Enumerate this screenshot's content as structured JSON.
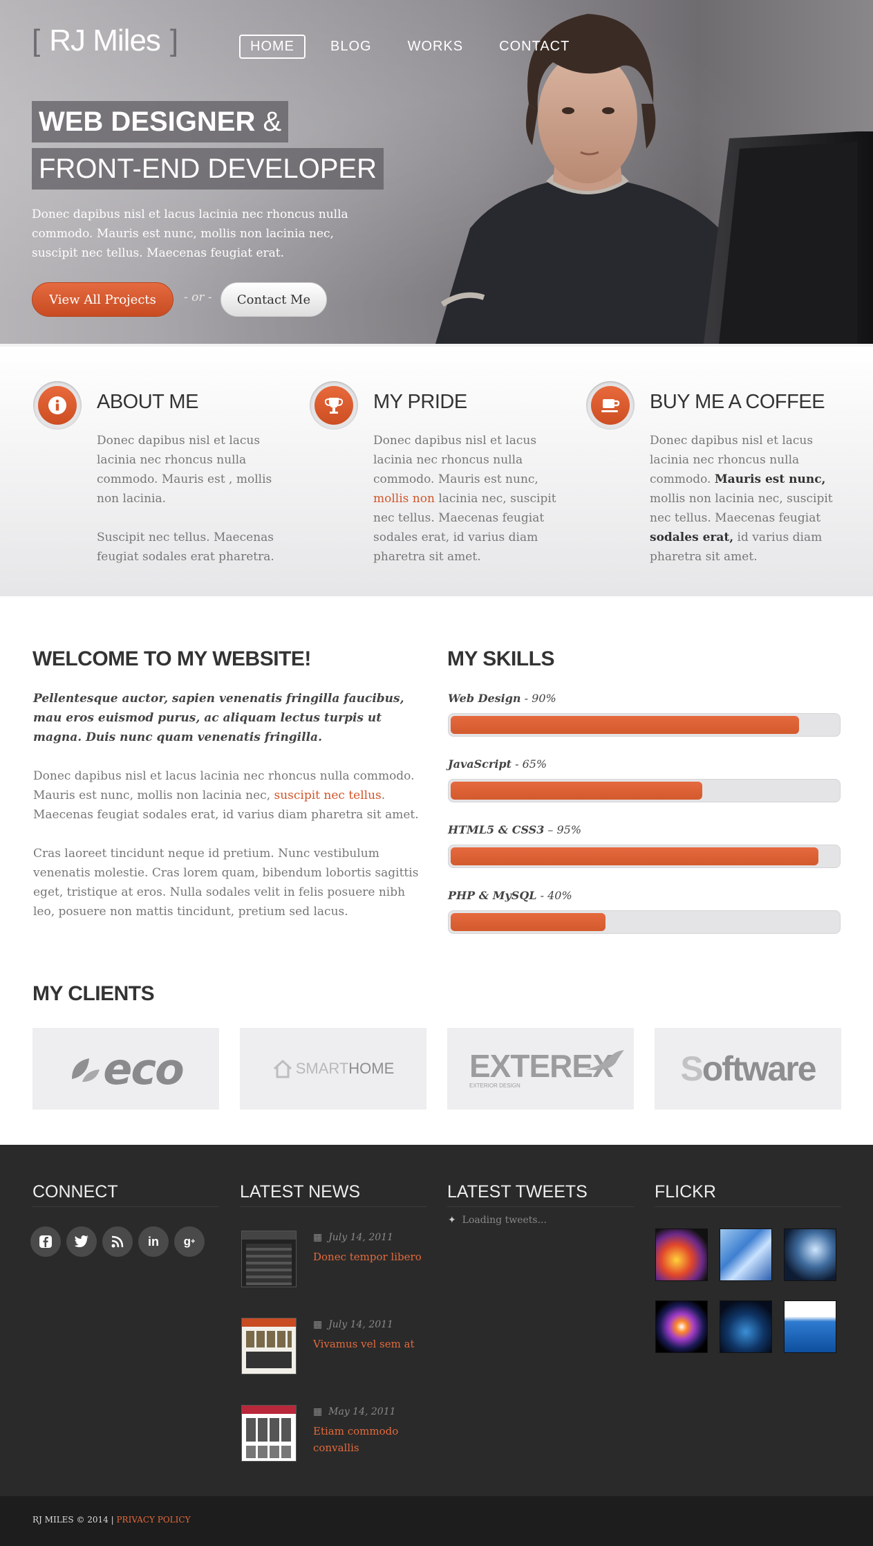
{
  "header": {
    "logo": {
      "bracket_left": "[",
      "name": "RJ Miles",
      "bracket_right": "]"
    },
    "nav": [
      {
        "label": "HOME",
        "active": true
      },
      {
        "label": "BLOG"
      },
      {
        "label": "WORKS"
      },
      {
        "label": "CONTACT"
      }
    ]
  },
  "hero": {
    "headline1_bold": "WEB DESIGNER",
    "headline1_amp": " &",
    "headline2": "FRONT-END DEVELOPER",
    "intro": "Donec dapibus nisl et lacus lacinia nec rhoncus nulla commodo. Mauris est nunc, mollis non lacinia nec, suscipit nec tellus. Maecenas feugiat erat.",
    "primary_button": "View All Projects",
    "or_text": "- or -",
    "secondary_button": "Contact Me"
  },
  "features": {
    "about": {
      "title": "ABOUT ME",
      "p1": "Donec dapibus nisl et lacus lacinia nec rhoncus nulla commodo. Mauris est , mollis non lacinia.",
      "p2": "Suscipit nec tellus. Maecenas feugiat sodales erat pharetra."
    },
    "pride": {
      "title": "MY PRIDE",
      "before_link": "Donec dapibus nisl et lacus lacinia nec rhoncus nulla commodo. Mauris est nunc, ",
      "link": "mollis non",
      "after_link": " lacinia nec, suscipit nec tellus. Maecenas feugiat sodales erat, id varius diam pharetra sit amet."
    },
    "coffee": {
      "title": "BUY ME A COFFEE",
      "t1": "Donec dapibus nisl et lacus lacinia nec rhoncus nulla commodo. ",
      "b1": "Mauris est nunc,",
      "t2": " mollis non lacinia nec, suscipit nec tellus. Maecenas feugiat ",
      "b2": "sodales erat,",
      "t3": " id varius diam pharetra sit amet."
    }
  },
  "welcome": {
    "title": "WELCOME TO MY WEBSITE!",
    "lead": "Pellentesque auctor, sapien venenatis fringilla faucibus, mau eros euismod purus, ac aliquam lectus turpis ut magna. Duis nunc quam venenatis fringilla.",
    "p1_before": "Donec dapibus nisl et lacus lacinia nec rhoncus nulla commodo. Mauris est nunc, mollis non lacinia nec, ",
    "p1_link": "suscipit nec tellus",
    "p1_after": ". Maecenas feugiat sodales erat, id varius diam pharetra sit amet.",
    "p2": "Cras laoreet tincidunt neque id pretium. Nunc vestibulum venenatis molestie. Cras lorem quam, bibendum lobortis sagittis eget, tristique at eros. Nulla sodales velit in felis posuere nibh leo, posuere non mattis tincidunt, pretium sed lacus."
  },
  "skills": {
    "title": "MY SKILLS",
    "items": [
      {
        "name": "Web Design",
        "suffix": " - 90%",
        "value": 0.9
      },
      {
        "name": "JavaScript",
        "suffix": " - 65%",
        "value": 0.65
      },
      {
        "name": "HTML5 & CSS3",
        "suffix": " – 95%",
        "value": 0.95
      },
      {
        "name": "PHP & MySQL",
        "suffix": " - 40%",
        "value": 0.4
      }
    ]
  },
  "clients": {
    "title": "MY CLIENTS",
    "logos": [
      {
        "text": "eco",
        "icon": "leaf-icon"
      },
      {
        "text_light": "SMART",
        "text_strong": "HOME",
        "icon": "house-icon"
      },
      {
        "text": "EXTEREX",
        "subtext": "EXTERIOR DESIGN",
        "icon": "bird-icon"
      },
      {
        "text_light": "S",
        "text_strong": "oftware"
      }
    ]
  },
  "footer": {
    "connect": {
      "title": "CONNECT",
      "icons": [
        "facebook-icon",
        "twitter-icon",
        "rss-icon",
        "linkedin-icon",
        "google-plus-icon"
      ]
    },
    "news": {
      "title": "LATEST NEWS",
      "items": [
        {
          "date": "July 14, 2011",
          "title": "Donec tempor libero"
        },
        {
          "date": "July 14, 2011",
          "title": "Vivamus vel sem at"
        },
        {
          "date": "May 14, 2011",
          "title": "Etiam commodo convallis"
        }
      ]
    },
    "tweets": {
      "title": "LATEST TWEETS",
      "loading": "Loading tweets..."
    },
    "flickr": {
      "title": "FLICKR"
    }
  },
  "bottom": {
    "copyright": "RJ MILES © 2014 | ",
    "privacy": "PRIVACY POLICY"
  },
  "colors": {
    "accent": "#d35a2d",
    "footer_bg": "#2a2a2a",
    "bottom_bg": "#1d1d1d"
  }
}
